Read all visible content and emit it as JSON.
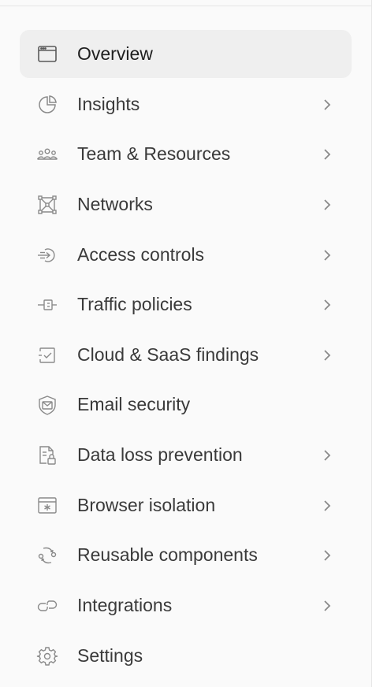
{
  "sidebar": {
    "items": [
      {
        "label": "Overview",
        "icon": "window-icon",
        "active": true,
        "has_submenu": false
      },
      {
        "label": "Insights",
        "icon": "pie-chart-icon",
        "active": false,
        "has_submenu": true
      },
      {
        "label": "Team & Resources",
        "icon": "team-icon",
        "active": false,
        "has_submenu": true
      },
      {
        "label": "Networks",
        "icon": "network-icon",
        "active": false,
        "has_submenu": true
      },
      {
        "label": "Access controls",
        "icon": "access-icon",
        "active": false,
        "has_submenu": true
      },
      {
        "label": "Traffic policies",
        "icon": "traffic-icon",
        "active": false,
        "has_submenu": true
      },
      {
        "label": "Cloud & SaaS findings",
        "icon": "cloud-check-icon",
        "active": false,
        "has_submenu": true
      },
      {
        "label": "Email security",
        "icon": "email-shield-icon",
        "active": false,
        "has_submenu": false
      },
      {
        "label": "Data loss prevention",
        "icon": "document-lock-icon",
        "active": false,
        "has_submenu": true
      },
      {
        "label": "Browser isolation",
        "icon": "browser-isolation-icon",
        "active": false,
        "has_submenu": true
      },
      {
        "label": "Reusable components",
        "icon": "reusable-icon",
        "active": false,
        "has_submenu": true
      },
      {
        "label": "Integrations",
        "icon": "link-icon",
        "active": false,
        "has_submenu": true
      },
      {
        "label": "Settings",
        "icon": "gear-icon",
        "active": false,
        "has_submenu": false
      }
    ]
  },
  "colors": {
    "sidebar_bg": "#fafafa",
    "active_bg": "#efefef",
    "text": "#3a3a3a",
    "icon": "#8a8a8a"
  }
}
